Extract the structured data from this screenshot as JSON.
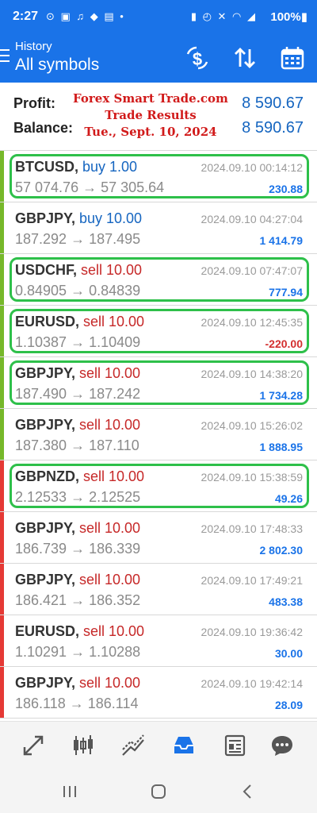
{
  "status_bar": {
    "time": "2:27",
    "left_icons": "⊙ ▣ ♫ ◆ ▤ •",
    "right_icons": "▮ ◴ ✕ ◠ ◢",
    "battery": "100%▮"
  },
  "header": {
    "subtitle": "History",
    "title": "All symbols"
  },
  "summary": {
    "profit_label": "Profit:",
    "profit_value": "8 590.67",
    "balance_label": "Balance:",
    "balance_value": "8 590.67"
  },
  "watermark": {
    "line1": "Forex Smart Trade.com",
    "line2": "Trade Results",
    "line3": "Tue., Sept. 10, 2024"
  },
  "colors": {
    "header_bg": "#1a73e8",
    "buy": "#1565c0",
    "sell": "#c62828",
    "profit_positive": "#1a73e8",
    "profit_negative": "#d32f2f",
    "buy_bar": "#76b82a",
    "sell_bar": "#e53935",
    "highlight": "#2ec04a"
  },
  "trades": [
    {
      "symbol": "BTCUSD,",
      "type": "buy 1.00",
      "side": "buy",
      "time": "2024.09.10 00:14:12",
      "prices": "57 074.76 → 57 305.64",
      "profit": "230.88",
      "highlighted": true
    },
    {
      "symbol": "GBPJPY,",
      "type": "buy 10.00",
      "side": "buy",
      "time": "2024.09.10 04:27:04",
      "prices": "187.292 → 187.495",
      "profit": "1 414.79",
      "highlighted": false
    },
    {
      "symbol": "USDCHF,",
      "type": "sell 10.00",
      "side": "sell",
      "bar": "buy",
      "time": "2024.09.10 07:47:07",
      "prices": "0.84905 → 0.84839",
      "profit": "777.94",
      "highlighted": true
    },
    {
      "symbol": "EURUSD,",
      "type": "sell 10.00",
      "side": "sell",
      "bar": "buy",
      "time": "2024.09.10 12:45:35",
      "prices": "1.10387 → 1.10409",
      "profit": "-220.00",
      "negative": true,
      "highlighted": true
    },
    {
      "symbol": "GBPJPY,",
      "type": "sell 10.00",
      "side": "sell",
      "bar": "buy",
      "time": "2024.09.10 14:38:20",
      "prices": "187.490 → 187.242",
      "profit": "1 734.28",
      "highlighted": true
    },
    {
      "symbol": "GBPJPY,",
      "type": "sell 10.00",
      "side": "sell",
      "bar": "buy",
      "time": "2024.09.10 15:26:02",
      "prices": "187.380 → 187.110",
      "profit": "1 888.95",
      "highlighted": false
    },
    {
      "symbol": "GBPNZD,",
      "type": "sell 10.00",
      "side": "sell",
      "time": "2024.09.10 15:38:59",
      "prices": "2.12533 → 2.12525",
      "profit": "49.26",
      "highlighted": true
    },
    {
      "symbol": "GBPJPY,",
      "type": "sell 10.00",
      "side": "sell",
      "time": "2024.09.10 17:48:33",
      "prices": "186.739 → 186.339",
      "profit": "2 802.30",
      "highlighted": false
    },
    {
      "symbol": "GBPJPY,",
      "type": "sell 10.00",
      "side": "sell",
      "time": "2024.09.10 17:49:21",
      "prices": "186.421 → 186.352",
      "profit": "483.38",
      "highlighted": false
    },
    {
      "symbol": "EURUSD,",
      "type": "sell 10.00",
      "side": "sell",
      "time": "2024.09.10 19:36:42",
      "prices": "1.10291 → 1.10288",
      "profit": "30.00",
      "highlighted": false
    },
    {
      "symbol": "GBPJPY,",
      "type": "sell 10.00",
      "side": "sell",
      "time": "2024.09.10 19:42:14",
      "prices": "186.118 → 186.114",
      "profit": "28.09",
      "highlighted": false
    }
  ],
  "bottom_nav": [
    {
      "name": "quotes-icon",
      "active": false
    },
    {
      "name": "chart-icon",
      "active": false
    },
    {
      "name": "trade-icon",
      "active": false
    },
    {
      "name": "history-icon",
      "active": true
    },
    {
      "name": "news-icon",
      "active": false
    },
    {
      "name": "messages-icon",
      "active": false
    }
  ]
}
